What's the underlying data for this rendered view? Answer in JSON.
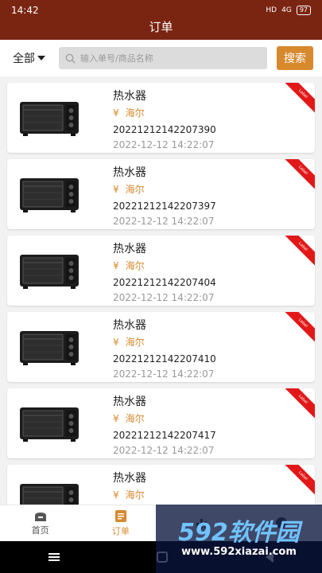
{
  "status_bar": {
    "time": "14:42",
    "network": "HD",
    "signal": "4G",
    "battery": "97"
  },
  "header": {
    "title": "订单"
  },
  "search": {
    "filter_label": "全部",
    "placeholder": "输入单号/商品名称",
    "button_label": "搜索"
  },
  "orders": [
    {
      "name": "热水器",
      "currency": "¥",
      "brand": "海尔",
      "order_no": "20221212142207390",
      "time": "2022-12-12 14:22:07",
      "ribbon": "Label"
    },
    {
      "name": "热水器",
      "currency": "¥",
      "brand": "海尔",
      "order_no": "20221212142207397",
      "time": "2022-12-12 14:22:07",
      "ribbon": "Label"
    },
    {
      "name": "热水器",
      "currency": "¥",
      "brand": "海尔",
      "order_no": "20221212142207404",
      "time": "2022-12-12 14:22:07",
      "ribbon": "Label"
    },
    {
      "name": "热水器",
      "currency": "¥",
      "brand": "海尔",
      "order_no": "20221212142207410",
      "time": "2022-12-12 14:22:07",
      "ribbon": "Label"
    },
    {
      "name": "热水器",
      "currency": "¥",
      "brand": "海尔",
      "order_no": "20221212142207417",
      "time": "2022-12-12 14:22:07",
      "ribbon": "Label"
    },
    {
      "name": "热水器",
      "currency": "¥",
      "brand": "海尔",
      "order_no": "",
      "time": "",
      "ribbon": "Label"
    }
  ],
  "tabbar": {
    "items": [
      {
        "label": "首页"
      },
      {
        "label": "订单"
      },
      {
        "label": ""
      },
      {
        "label": ""
      }
    ]
  },
  "watermark": {
    "main": "592软件园",
    "url": "www.592xiazai.com"
  },
  "colors": {
    "header_bg": "#7a2512",
    "accent": "#d7892d",
    "ribbon": "#e21818"
  }
}
